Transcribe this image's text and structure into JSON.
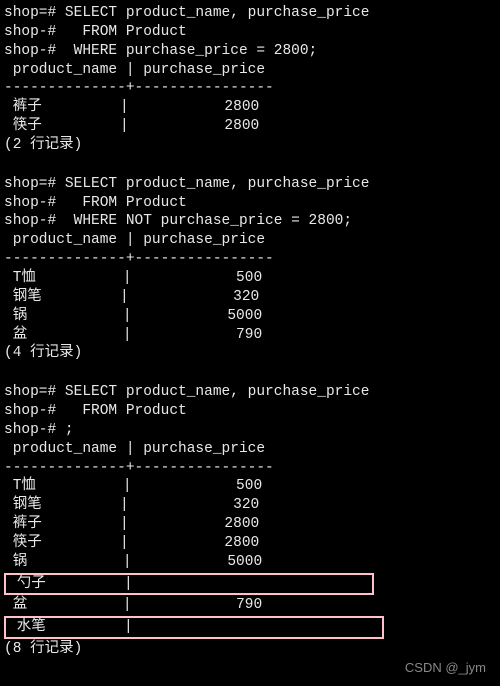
{
  "q1": {
    "l1": "shop=# SELECT product_name, purchase_price",
    "l2": "shop-#   FROM Product",
    "l3": "shop-#  WHERE purchase_price = 2800;",
    "hdr": " product_name | purchase_price",
    "sep": "--------------+----------------",
    "r1": " 裤子         |           2800",
    "r2": " 筷子         |           2800",
    "cnt": "(2 行记录)"
  },
  "q2": {
    "l1": "shop=# SELECT product_name, purchase_price",
    "l2": "shop-#   FROM Product",
    "l3": "shop-#  WHERE NOT purchase_price = 2800;",
    "hdr": " product_name | purchase_price",
    "sep": "--------------+----------------",
    "r1": " T恤          |            500",
    "r2": " 钢笔         |            320",
    "r3": " 锅           |           5000",
    "r4": " 盆           |            790",
    "cnt": "(4 行记录)"
  },
  "q3": {
    "l1": "shop=# SELECT product_name, purchase_price",
    "l2": "shop-#   FROM Product",
    "l3": "shop-# ;",
    "hdr": " product_name | purchase_price",
    "sep": "--------------+----------------",
    "r1": " T恤          |            500",
    "r2": " 钢笔         |            320",
    "r3": " 裤子         |           2800",
    "r4": " 筷子         |           2800",
    "r5": " 锅           |           5000",
    "r6": " 勺子         |",
    "r7": " 盆           |            790",
    "r8": " 水笔         |",
    "cnt": "(8 行记录)"
  },
  "watermark": "CSDN @_jym"
}
